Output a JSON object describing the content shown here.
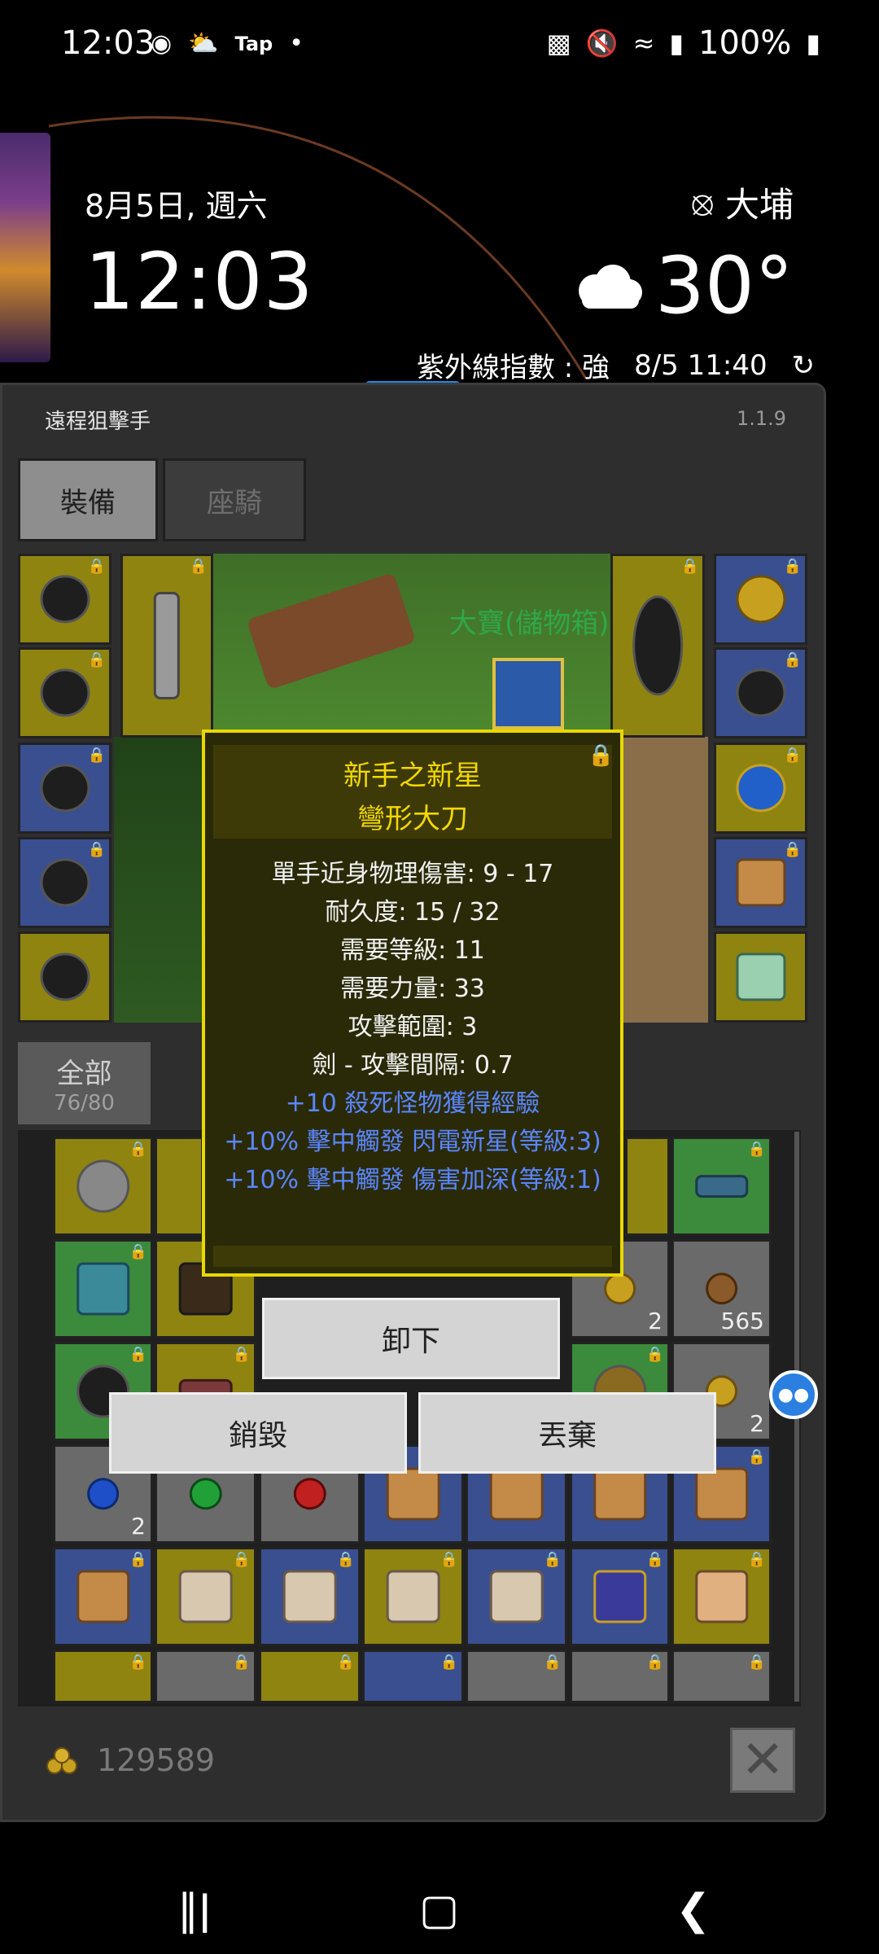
{
  "status_bar": {
    "time": "12:03",
    "left_icons": [
      "camera-icon",
      "weather-icon",
      "tap-icon",
      "dot-icon"
    ],
    "tap_label": "Tap",
    "battery": "100%"
  },
  "lock_widget": {
    "date": "8月5日, 週六",
    "clock": "12:03",
    "location": "大埔",
    "temperature": "30°",
    "uv": "紫外線指數 : 強",
    "updated": "8/5 11:40"
  },
  "game": {
    "title": "遠程狙擊手",
    "version": "1.1.9",
    "tabs": [
      "裝備",
      "座騎"
    ],
    "chest_label": "大寶(儲物箱)",
    "filter": {
      "label": "全部",
      "count": "76/80"
    },
    "tooltip": {
      "name1": "新手之新星",
      "name2": "彎形大刀",
      "lines": [
        "單手近身物理傷害: 9 - 17",
        "耐久度: 15 / 32",
        "需要等級: 11",
        "需要力量: 33",
        "攻擊範圍: 3",
        "劍 - 攻擊間隔: 0.7"
      ],
      "bonus_lines": [
        "+10 殺死怪物獲得經驗",
        "+10% 擊中觸發 閃電新星(等級:3)",
        "+10% 擊中觸發 傷害加深(等級:1)"
      ]
    },
    "actions": {
      "unequip": "卸下",
      "destroy": "銷毀",
      "discard": "丟棄"
    },
    "inventory_counts": {
      "c1": "2",
      "c2": "565",
      "c3": "2",
      "c4": "2"
    },
    "gold": "129589"
  },
  "colors": {
    "accent": "#1e88e5",
    "tooltip_border": "#e8d800",
    "tooltip_title": "#f3d800",
    "bonus_text": "#5a86ff"
  }
}
